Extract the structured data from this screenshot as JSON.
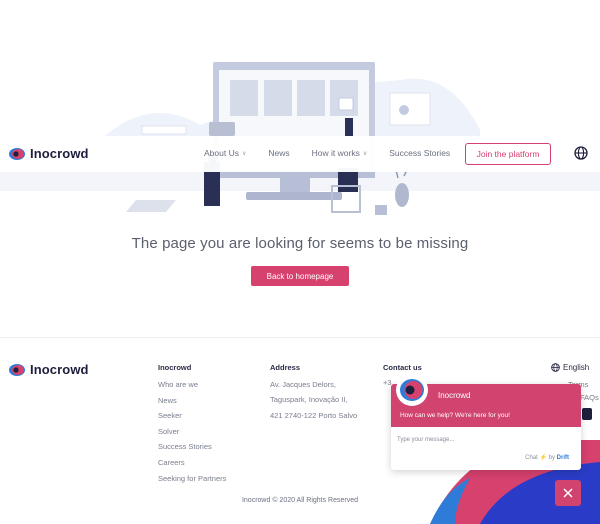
{
  "header": {
    "logo_text": "Inocrowd",
    "nav": [
      {
        "label": "About Us",
        "dropdown": true
      },
      {
        "label": "News",
        "dropdown": false
      },
      {
        "label": "How it works",
        "dropdown": true
      },
      {
        "label": "Success Stories",
        "dropdown": false
      }
    ],
    "join_label": "Join the platform"
  },
  "main": {
    "message": "The page you are looking for seems to be missing",
    "back_label": "Back to homepage"
  },
  "footer": {
    "logo_text": "Inocrowd",
    "col1": {
      "heading": "Inocrowd",
      "items": [
        "Who are we",
        "News",
        "Seeker",
        "Solver",
        "Success Stories",
        "Careers",
        "Seeking for Partners"
      ]
    },
    "address": {
      "heading": "Address",
      "lines": [
        "Av. Jacques Delors,",
        "Taguspark, Inovação II,",
        "421 2740-122 Porto Salvo"
      ]
    },
    "contact": {
      "heading": "Contact us",
      "partial_phone": "+3",
      "partial_terms": "Terms",
      "partial_faqs": "FAQs"
    },
    "language": "English",
    "copyright": "Inocrowd © 2020 All Rights Reserved"
  },
  "chat": {
    "name": "Inocrowd",
    "subtitle": "How can we help? We're here for you!",
    "input_placeholder": "Type your message...",
    "by_prefix": "Chat",
    "by_word": "by",
    "provider": "Drift"
  },
  "colors": {
    "brand": "#d6416e",
    "dark": "#1d1f3c",
    "accent_blue": "#2f7bd8"
  }
}
